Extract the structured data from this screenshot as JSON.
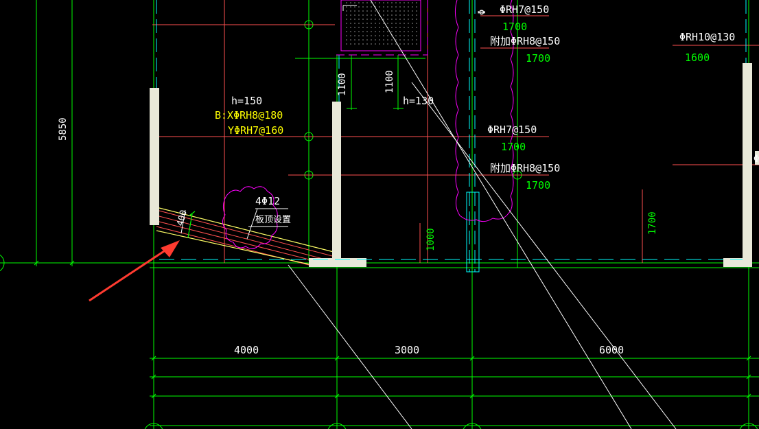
{
  "colors": {
    "background": "#000000",
    "grid": "#00ff00",
    "rebar_line": "#ff5050",
    "magenta": "#ff00ff",
    "wall": "#e8e8d8",
    "yellow": "#ffff00",
    "white": "#ffffff",
    "cyan": "#00ffff",
    "annotation_green": "#00ff00",
    "arrow": "#ff3b30"
  },
  "dimensions": {
    "vertical_5850": "5850",
    "span_4000": "4000",
    "span_3000": "3000",
    "span_6000": "6000"
  },
  "slab_left": {
    "thickness": "h=150",
    "bottom_x": "B:XΦRH8@180",
    "bottom_y": "YΦRH7@160"
  },
  "slab_mid": {
    "thickness": "h=130"
  },
  "opening_dims": {
    "left": "1100",
    "right": "1100"
  },
  "rebar_labels": [
    {
      "text": "ΦRH7@150",
      "length": "1700"
    },
    {
      "text": "附加ΦRH8@150",
      "length": "1700"
    },
    {
      "text": "ΦRH7@150",
      "length": "1700"
    },
    {
      "text": "附加ΦRH8@150",
      "length": "1700"
    },
    {
      "text": "ΦRH10@130",
      "length": "1600"
    }
  ],
  "beam_note": {
    "bars": "4Φ12",
    "note": "板顶设置",
    "depth": "400"
  },
  "support_lengths": {
    "mid": "1000",
    "right": "1700"
  },
  "right_edge_mark": "Φ",
  "top_right_mark": "Φ"
}
